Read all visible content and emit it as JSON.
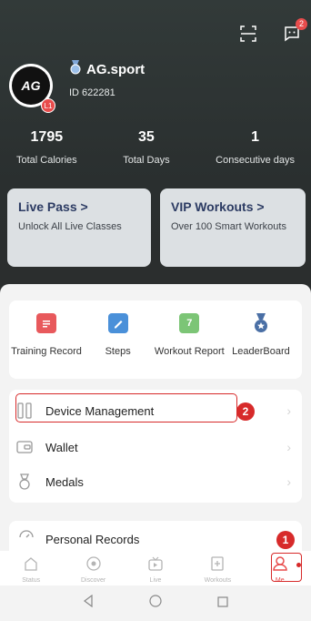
{
  "header": {
    "notification_count": "2",
    "username": "AG.sport",
    "user_id": "ID  622281",
    "avatar_text": "AG",
    "level": "L1"
  },
  "stats": [
    {
      "value": "1795",
      "label": "Total Calories"
    },
    {
      "value": "35",
      "label": "Total Days"
    },
    {
      "value": "1",
      "label": "Consecutive days"
    }
  ],
  "promos": {
    "live": {
      "title": "Live Pass >",
      "subtitle": "Unlock All Live Classes"
    },
    "vip": {
      "title": "VIP Workouts >",
      "subtitle": "Over 100 Smart Workouts"
    }
  },
  "quick_actions": [
    {
      "label": "Training Record",
      "icon": "training-record-icon",
      "color": "#e8595c"
    },
    {
      "label": "Steps",
      "icon": "steps-icon",
      "color": "#4a90d9"
    },
    {
      "label": "Workout Report",
      "icon": "workout-report-icon",
      "color": "#7cc576"
    },
    {
      "label": "LeaderBoard",
      "icon": "leaderboard-icon",
      "color": "#4a6fa5"
    }
  ],
  "menu": {
    "device_management": "Device Management",
    "wallet": "Wallet",
    "medals": "Medals",
    "personal_records": "Personal Records"
  },
  "annotations": {
    "step1": "1",
    "step2": "2"
  },
  "report_icon_day": "7",
  "nav": [
    {
      "label": "Status",
      "icon": "home-icon"
    },
    {
      "label": "Discover",
      "icon": "compass-icon"
    },
    {
      "label": "Live",
      "icon": "live-tv-icon"
    },
    {
      "label": "Workouts",
      "icon": "workouts-icon"
    },
    {
      "label": "Me",
      "icon": "person-icon"
    }
  ],
  "colors": {
    "accent_red": "#d72a2a",
    "promo_title": "#2c3b63"
  }
}
